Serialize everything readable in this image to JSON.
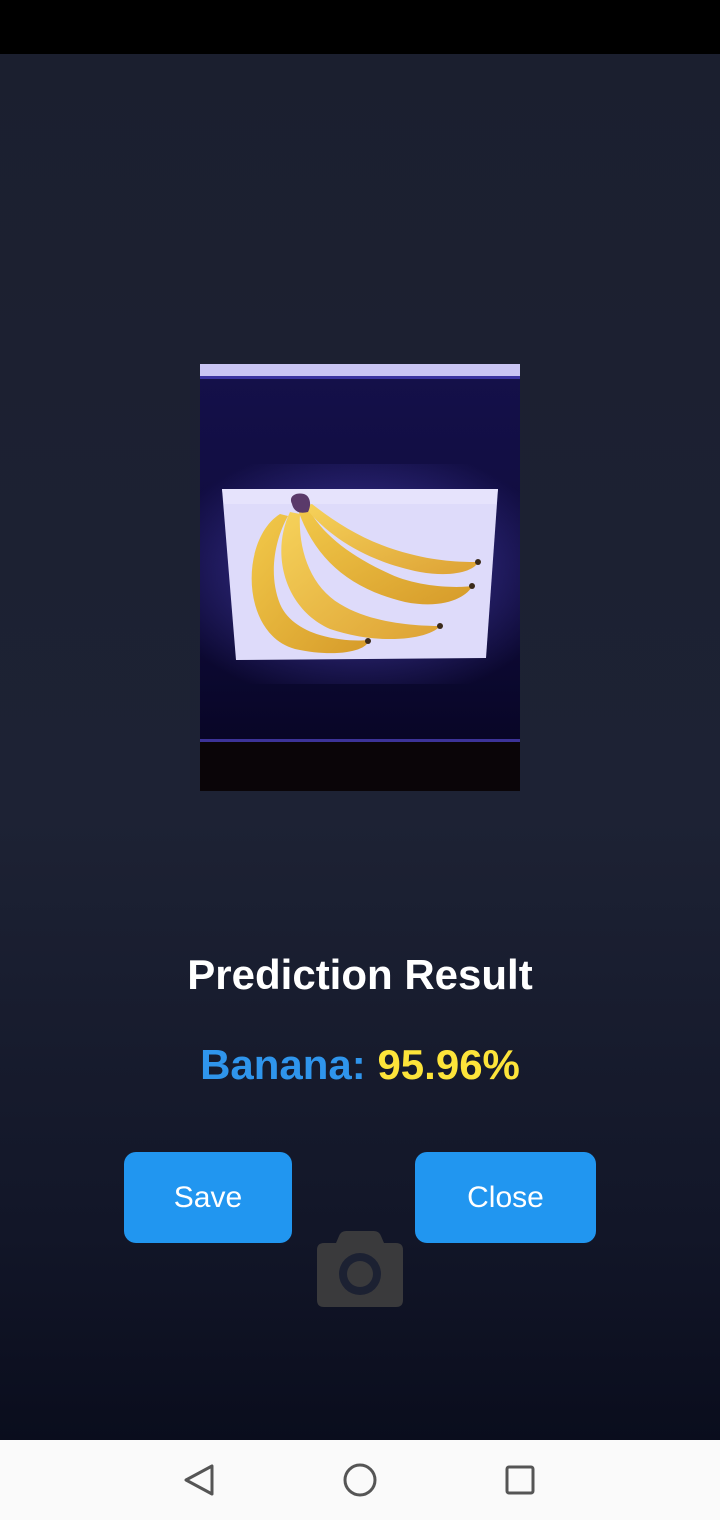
{
  "result": {
    "title": "Prediction Result",
    "label": "Banana:",
    "confidence": "95.96%"
  },
  "buttons": {
    "save_label": "Save",
    "close_label": "Close"
  },
  "icons": {
    "camera": "camera-icon",
    "back": "back-icon",
    "home": "home-icon",
    "recents": "recents-icon"
  },
  "colors": {
    "label": "#2f95ec",
    "confidence": "#fde43a",
    "button": "#2196f0"
  }
}
